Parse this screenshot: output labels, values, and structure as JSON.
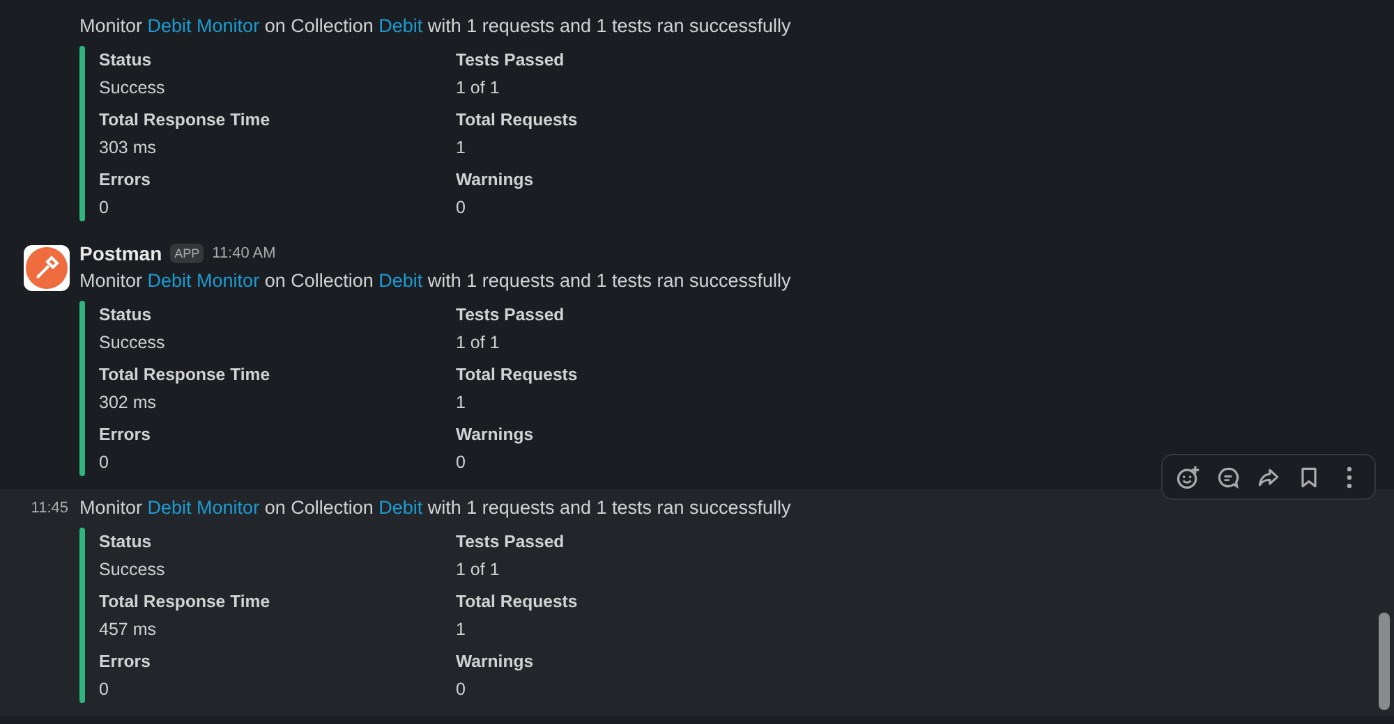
{
  "messages": [
    {
      "hovered": false,
      "summary": [
        {
          "text": "Monitor "
        },
        {
          "text": "Debit Monitor",
          "link": true
        },
        {
          "text": " on Collection "
        },
        {
          "text": "Debit",
          "link": true
        },
        {
          "text": " with 1 requests and 1 tests ran successfully"
        }
      ],
      "fields": [
        {
          "label": "Status",
          "value": "Success"
        },
        {
          "label": "Tests Passed",
          "value": "1 of 1"
        },
        {
          "label": "Total Response Time",
          "value": "303 ms"
        },
        {
          "label": "Total Requests",
          "value": "1"
        },
        {
          "label": "Errors",
          "value": "0"
        },
        {
          "label": "Warnings",
          "value": "0"
        }
      ]
    },
    {
      "hovered": false,
      "sender": "Postman",
      "badge": "APP",
      "time": "11:40 AM",
      "summary": [
        {
          "text": "Monitor "
        },
        {
          "text": "Debit Monitor",
          "link": true
        },
        {
          "text": " on Collection "
        },
        {
          "text": "Debit",
          "link": true
        },
        {
          "text": " with 1 requests and 1 tests ran successfully"
        }
      ],
      "fields": [
        {
          "label": "Status",
          "value": "Success"
        },
        {
          "label": "Tests Passed",
          "value": "1 of 1"
        },
        {
          "label": "Total Response Time",
          "value": "302 ms"
        },
        {
          "label": "Total Requests",
          "value": "1"
        },
        {
          "label": "Errors",
          "value": "0"
        },
        {
          "label": "Warnings",
          "value": "0"
        }
      ]
    },
    {
      "hovered": true,
      "time": "11:45",
      "summary": [
        {
          "text": "Monitor "
        },
        {
          "text": "Debit Monitor",
          "link": true
        },
        {
          "text": " on Collection "
        },
        {
          "text": "Debit",
          "link": true
        },
        {
          "text": " with 1 requests and 1 tests ran successfully"
        }
      ],
      "fields": [
        {
          "label": "Status",
          "value": "Success"
        },
        {
          "label": "Tests Passed",
          "value": "1 of 1"
        },
        {
          "label": "Total Response Time",
          "value": "457 ms"
        },
        {
          "label": "Total Requests",
          "value": "1"
        },
        {
          "label": "Errors",
          "value": "0"
        },
        {
          "label": "Warnings",
          "value": "0"
        }
      ]
    }
  ]
}
